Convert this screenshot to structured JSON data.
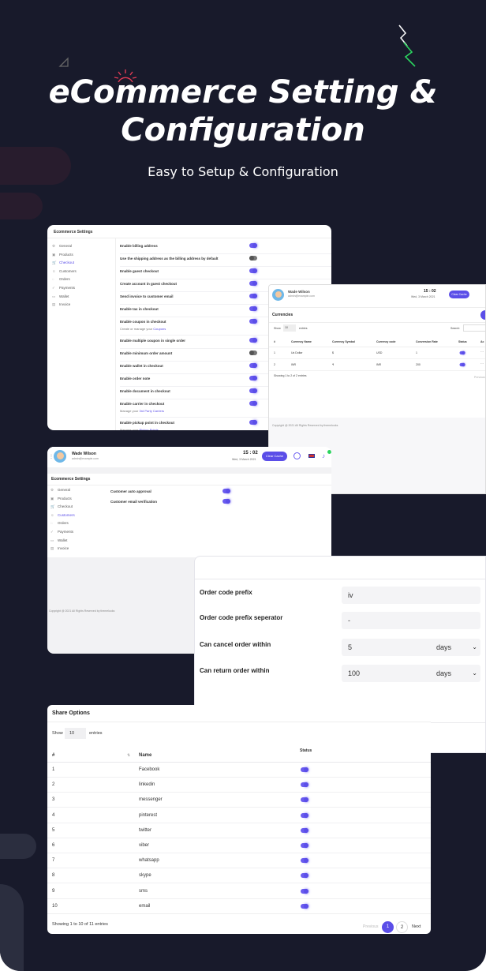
{
  "hero": {
    "title_line1": "eCommerce Setting &",
    "title_line2": "Configuration",
    "subtitle": "Easy to Setup & Configuration"
  },
  "card1": {
    "title": "Ecommerce Settings",
    "sidebar": [
      {
        "label": "General",
        "icon": "gear-icon",
        "glyph": "⚙"
      },
      {
        "label": "Products",
        "icon": "box-icon",
        "glyph": "▣"
      },
      {
        "label": "Checkout",
        "icon": "cart-icon",
        "glyph": "🛒",
        "active": true
      },
      {
        "label": "Customers",
        "icon": "users-icon",
        "glyph": "☺"
      },
      {
        "label": "Orders",
        "icon": "bag-icon",
        "glyph": "◌"
      },
      {
        "label": "Payments",
        "icon": "card-icon",
        "glyph": "✓"
      },
      {
        "label": "Wallet",
        "icon": "wallet-icon",
        "glyph": "▭"
      },
      {
        "label": "Invoice",
        "icon": "invoice-icon",
        "glyph": "▤"
      }
    ],
    "rows": [
      {
        "label": "Enable billing address",
        "on": true
      },
      {
        "label": "Use the shipping address as the billing address by default",
        "on": false
      },
      {
        "label": "Enable guest checkout",
        "on": true
      },
      {
        "label": "Create account in guest checkout",
        "on": true
      },
      {
        "label": "Send invoice to customer email",
        "on": true
      },
      {
        "label": "Enable tax in checkout",
        "on": true
      },
      {
        "label": "Enable coupon in checkout",
        "on": true,
        "sub": "Create or manage your",
        "link": "Coupons"
      },
      {
        "label": "Enable multiple coupon in single order",
        "on": true
      },
      {
        "label": "Enable minimum order amount",
        "on": false
      },
      {
        "label": "Enable wallet in checkout",
        "on": true
      },
      {
        "label": "Enable order note",
        "on": true
      },
      {
        "label": "Enable document in checkout",
        "on": true
      },
      {
        "label": "Enable carrier in checkout",
        "on": true,
        "sub": "Manage your",
        "link": "3rd Party Carriers"
      },
      {
        "label": "Enable pickup point in checkout",
        "on": true,
        "sub": "Manage your",
        "link": "Pickup Points"
      }
    ]
  },
  "card2": {
    "user_name": "Wade Wilson",
    "user_email": "admin@example.com",
    "time": "15 : 02",
    "date": "Wed, 3 March 2021",
    "btn": "Clear Cache",
    "section": "Currencies",
    "show": "Show",
    "entries_val": "10",
    "entries": "entries",
    "search": "Search:",
    "headers": [
      "#",
      "",
      "Currency Name",
      "Currency Symbol",
      "Currency code",
      "Conversion Rate",
      "Status",
      "Ac"
    ],
    "rows": [
      {
        "n": "1",
        "name": "Us Dollar",
        "sym": "$",
        "code": "USD",
        "rate": "1"
      },
      {
        "n": "2",
        "name": "INR",
        "sym": "₹",
        "code": "INR",
        "rate": "200"
      }
    ],
    "showing": "Showing 1 to 2 of 2 entries",
    "prev": "Previous",
    "footer": "Copyright @ 2021 All Rights Reserved by themelooks"
  },
  "card3": {
    "user_name": "Wade Wilson",
    "user_email": "admin@example.com",
    "time": "15 : 02",
    "date": "Wed, 3 March 2021",
    "btn": "Clear Cache",
    "title": "Ecommerce Settings",
    "sidebar": [
      {
        "label": "General",
        "icon": "gear-icon",
        "glyph": "⚙"
      },
      {
        "label": "Products",
        "icon": "box-icon",
        "glyph": "▣"
      },
      {
        "label": "Checkout",
        "icon": "cart-icon",
        "glyph": "🛒"
      },
      {
        "label": "Customers",
        "icon": "users-icon",
        "glyph": "☺",
        "active": true
      },
      {
        "label": "Orders",
        "icon": "bag-icon",
        "glyph": "◌"
      },
      {
        "label": "Payments",
        "icon": "card-icon",
        "glyph": "✓"
      },
      {
        "label": "Wallet",
        "icon": "wallet-icon",
        "glyph": "▭"
      },
      {
        "label": "Invoice",
        "icon": "invoice-icon",
        "glyph": "▤"
      }
    ],
    "rows": [
      {
        "label": "Customer auto approval"
      },
      {
        "label": "Customer email verification"
      }
    ],
    "footer": "Copyright @ 2021 All Rights Reserved by themelooks"
  },
  "card4": {
    "fields": [
      {
        "label": "Order code prefix",
        "value": "iv"
      },
      {
        "label": "Order code prefix seperator",
        "value": "-"
      },
      {
        "label": "Can cancel order within",
        "value": "5",
        "unit": "days"
      },
      {
        "label": "Can return order within",
        "value": "100",
        "unit": "days"
      }
    ]
  },
  "card5": {
    "title": "Share Options",
    "show": "Show",
    "entries_val": "10",
    "entries": "entries",
    "col_num": "#",
    "col_name": "Name",
    "col_status": "Status",
    "rows": [
      {
        "n": "1",
        "name": "Facebook"
      },
      {
        "n": "2",
        "name": "linkedin"
      },
      {
        "n": "3",
        "name": "messenger"
      },
      {
        "n": "4",
        "name": "pinterest"
      },
      {
        "n": "5",
        "name": "twitter"
      },
      {
        "n": "6",
        "name": "viber"
      },
      {
        "n": "7",
        "name": "whatsapp"
      },
      {
        "n": "8",
        "name": "skype"
      },
      {
        "n": "9",
        "name": "sms"
      },
      {
        "n": "10",
        "name": "email"
      }
    ],
    "showing": "Showing 1 to 10 of 11 entries",
    "prev": "Previous",
    "page1": "1",
    "page2": "2",
    "next": "Next"
  }
}
